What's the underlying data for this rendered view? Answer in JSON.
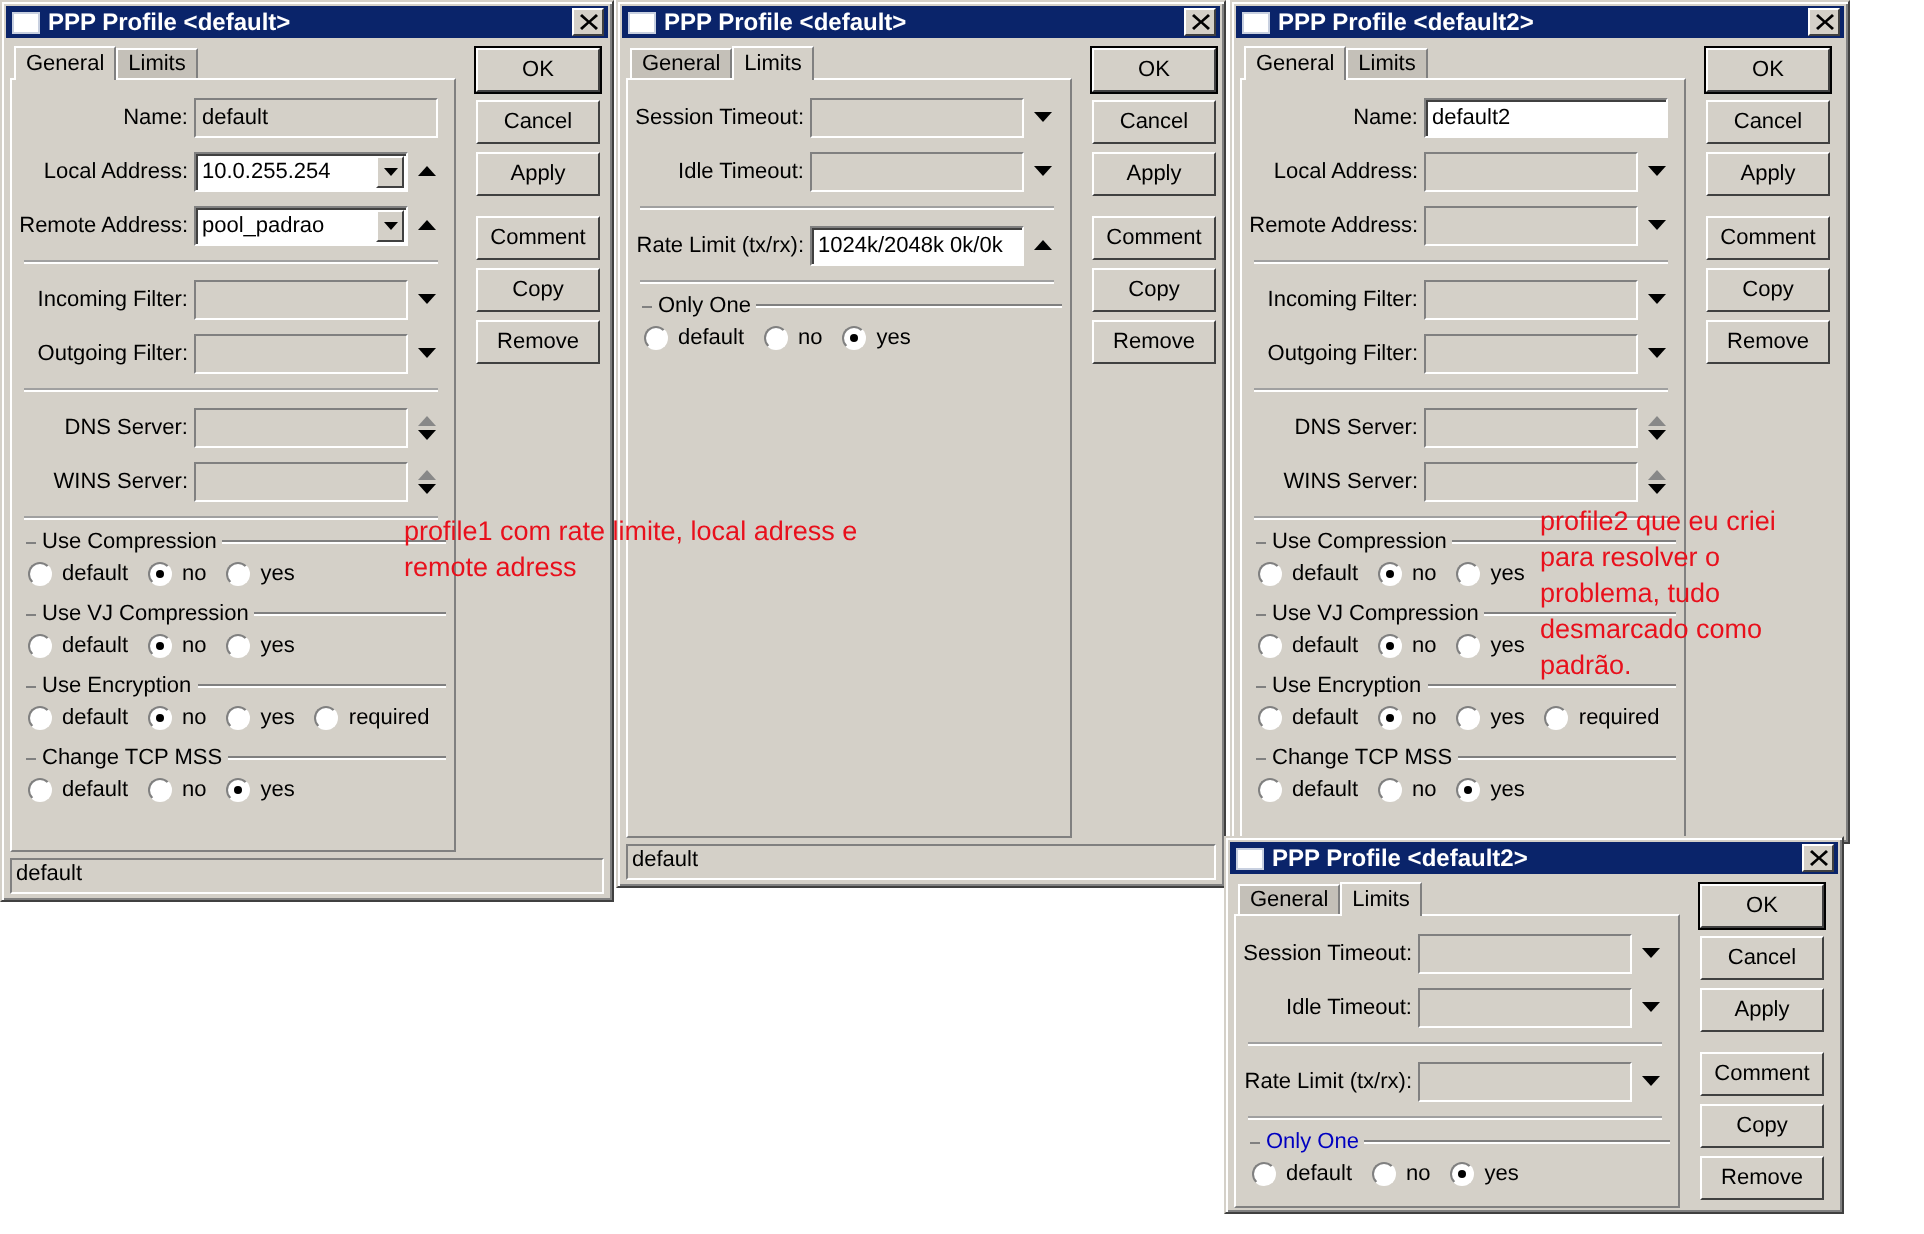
{
  "windows": [
    {
      "title": "PPP Profile <default>",
      "tabs": [
        {
          "label": "General",
          "selected": true
        },
        {
          "label": "Limits",
          "selected": false
        }
      ],
      "rows": [
        {
          "kind": "field",
          "label": "Name:",
          "value": "default",
          "editable": false,
          "dropdown": false,
          "up_arrow": false,
          "down_arrow": false
        },
        {
          "kind": "field",
          "label": "Local Address:",
          "value": "10.0.255.254",
          "editable": true,
          "dropdown": true,
          "up_arrow": true,
          "down_arrow": false
        },
        {
          "kind": "field",
          "label": "Remote Address:",
          "value": "pool_padrao",
          "editable": true,
          "dropdown": true,
          "up_arrow": true,
          "down_arrow": false
        },
        {
          "kind": "separator"
        },
        {
          "kind": "field",
          "label": "Incoming Filter:",
          "editable": false,
          "dropdown": false,
          "up_arrow": false,
          "down_arrow": true
        },
        {
          "kind": "field",
          "label": "Outgoing Filter:",
          "editable": false,
          "dropdown": false,
          "up_arrow": false,
          "down_arrow": true
        },
        {
          "kind": "separator"
        },
        {
          "kind": "field",
          "label": "DNS Server:",
          "editable": false,
          "dropdown": false,
          "up_arrow": true,
          "down_arrow": true
        },
        {
          "kind": "field",
          "label": "WINS Server:",
          "editable": false,
          "dropdown": false,
          "up_arrow": true,
          "down_arrow": true
        },
        {
          "kind": "separator"
        },
        {
          "kind": "radio_group",
          "title": "Use Compression",
          "highlighted": false,
          "options": [
            {
              "label": "default",
              "selected": false
            },
            {
              "label": "no",
              "selected": true
            },
            {
              "label": "yes",
              "selected": false
            }
          ]
        },
        {
          "kind": "radio_group",
          "title": "Use VJ Compression",
          "highlighted": false,
          "options": [
            {
              "label": "default",
              "selected": false
            },
            {
              "label": "no",
              "selected": true
            },
            {
              "label": "yes",
              "selected": false
            }
          ]
        },
        {
          "kind": "radio_group",
          "title": "Use Encryption",
          "highlighted": false,
          "options": [
            {
              "label": "default",
              "selected": false
            },
            {
              "label": "no",
              "selected": true
            },
            {
              "label": "yes",
              "selected": false
            },
            {
              "label": "required",
              "selected": false
            }
          ]
        },
        {
          "kind": "radio_group",
          "title": "Change TCP MSS",
          "highlighted": false,
          "options": [
            {
              "label": "default",
              "selected": false
            },
            {
              "label": "no",
              "selected": false
            },
            {
              "label": "yes",
              "selected": true
            }
          ]
        }
      ],
      "buttons": [
        {
          "label": "OK",
          "default": true
        },
        {
          "label": "Cancel",
          "default": false
        },
        {
          "label": "Apply",
          "default": false
        },
        {
          "label": "Comment",
          "default": false
        },
        {
          "label": "Copy",
          "default": false
        },
        {
          "label": "Remove",
          "default": false
        }
      ],
      "status_bar": "default"
    },
    {
      "title": "PPP Profile <default>",
      "tabs": [
        {
          "label": "General",
          "selected": false
        },
        {
          "label": "Limits",
          "selected": true
        }
      ],
      "rows": [
        {
          "kind": "field",
          "label": "Session Timeout:",
          "editable": false,
          "dropdown": false,
          "up_arrow": false,
          "down_arrow": true
        },
        {
          "kind": "field",
          "label": "Idle Timeout:",
          "editable": false,
          "dropdown": false,
          "up_arrow": false,
          "down_arrow": true
        },
        {
          "kind": "separator"
        },
        {
          "kind": "field",
          "label": "Rate Limit (tx/rx):",
          "value": "1024k/2048k 0k/0k",
          "editable": true,
          "dropdown": false,
          "up_arrow": true,
          "down_arrow": false
        },
        {
          "kind": "separator"
        },
        {
          "kind": "radio_group",
          "title": "Only One",
          "highlighted": false,
          "options": [
            {
              "label": "default",
              "selected": false
            },
            {
              "label": "no",
              "selected": false
            },
            {
              "label": "yes",
              "selected": true
            }
          ]
        }
      ],
      "buttons": [
        {
          "label": "OK",
          "default": true
        },
        {
          "label": "Cancel",
          "default": false
        },
        {
          "label": "Apply",
          "default": false
        },
        {
          "label": "Comment",
          "default": false
        },
        {
          "label": "Copy",
          "default": false
        },
        {
          "label": "Remove",
          "default": false
        }
      ],
      "status_bar": "default"
    },
    {
      "title": "PPP Profile <default2>",
      "tabs": [
        {
          "label": "General",
          "selected": true
        },
        {
          "label": "Limits",
          "selected": false
        }
      ],
      "rows": [
        {
          "kind": "field",
          "label": "Name:",
          "value": "default2",
          "editable": true,
          "dropdown": false,
          "up_arrow": false,
          "down_arrow": false
        },
        {
          "kind": "field",
          "label": "Local Address:",
          "editable": false,
          "dropdown": false,
          "up_arrow": false,
          "down_arrow": true
        },
        {
          "kind": "field",
          "label": "Remote Address:",
          "editable": false,
          "dropdown": false,
          "up_arrow": false,
          "down_arrow": true
        },
        {
          "kind": "separator"
        },
        {
          "kind": "field",
          "label": "Incoming Filter:",
          "editable": false,
          "dropdown": false,
          "up_arrow": false,
          "down_arrow": true
        },
        {
          "kind": "field",
          "label": "Outgoing Filter:",
          "editable": false,
          "dropdown": false,
          "up_arrow": false,
          "down_arrow": true
        },
        {
          "kind": "separator"
        },
        {
          "kind": "field",
          "label": "DNS Server:",
          "editable": false,
          "dropdown": false,
          "up_arrow": true,
          "down_arrow": true
        },
        {
          "kind": "field",
          "label": "WINS Server:",
          "editable": false,
          "dropdown": false,
          "up_arrow": true,
          "down_arrow": true
        },
        {
          "kind": "separator"
        },
        {
          "kind": "radio_group",
          "title": "Use Compression",
          "highlighted": false,
          "options": [
            {
              "label": "default",
              "selected": false
            },
            {
              "label": "no",
              "selected": true
            },
            {
              "label": "yes",
              "selected": false
            }
          ]
        },
        {
          "kind": "radio_group",
          "title": "Use VJ Compression",
          "highlighted": false,
          "options": [
            {
              "label": "default",
              "selected": false
            },
            {
              "label": "no",
              "selected": true
            },
            {
              "label": "yes",
              "selected": false
            }
          ]
        },
        {
          "kind": "radio_group",
          "title": "Use Encryption",
          "highlighted": false,
          "options": [
            {
              "label": "default",
              "selected": false
            },
            {
              "label": "no",
              "selected": true
            },
            {
              "label": "yes",
              "selected": false
            },
            {
              "label": "required",
              "selected": false
            }
          ]
        },
        {
          "kind": "radio_group",
          "title": "Change TCP MSS",
          "highlighted": false,
          "options": [
            {
              "label": "default",
              "selected": false
            },
            {
              "label": "no",
              "selected": false
            },
            {
              "label": "yes",
              "selected": true
            }
          ]
        }
      ],
      "buttons": [
        {
          "label": "OK",
          "default": true
        },
        {
          "label": "Cancel",
          "default": false
        },
        {
          "label": "Apply",
          "default": false
        },
        {
          "label": "Comment",
          "default": false
        },
        {
          "label": "Copy",
          "default": false
        },
        {
          "label": "Remove",
          "default": false
        }
      ]
    },
    {
      "title": "PPP Profile <default2>",
      "tabs": [
        {
          "label": "General",
          "selected": false
        },
        {
          "label": "Limits",
          "selected": true
        }
      ],
      "rows": [
        {
          "kind": "field",
          "label": "Session Timeout:",
          "editable": false,
          "dropdown": false,
          "up_arrow": false,
          "down_arrow": true
        },
        {
          "kind": "field",
          "label": "Idle Timeout:",
          "editable": false,
          "dropdown": false,
          "up_arrow": false,
          "down_arrow": true
        },
        {
          "kind": "separator"
        },
        {
          "kind": "field",
          "label": "Rate Limit (tx/rx):",
          "editable": false,
          "dropdown": false,
          "up_arrow": false,
          "down_arrow": true
        },
        {
          "kind": "separator"
        },
        {
          "kind": "radio_group",
          "title": "Only One",
          "highlighted": true,
          "options": [
            {
              "label": "default",
              "selected": false
            },
            {
              "label": "no",
              "selected": false
            },
            {
              "label": "yes",
              "selected": true
            }
          ]
        }
      ],
      "buttons": [
        {
          "label": "OK",
          "default": true
        },
        {
          "label": "Cancel",
          "default": false
        },
        {
          "label": "Apply",
          "default": false
        },
        {
          "label": "Comment",
          "default": false
        },
        {
          "label": "Copy",
          "default": false
        },
        {
          "label": "Remove",
          "default": false
        }
      ]
    }
  ],
  "notes": [
    {
      "text": "profile1 com rate limite, local adress e\nremote adress"
    },
    {
      "text": "profile2 que eu criei\npara resolver o\nproblema, tudo\ndesmarcado como\npadrão."
    }
  ]
}
